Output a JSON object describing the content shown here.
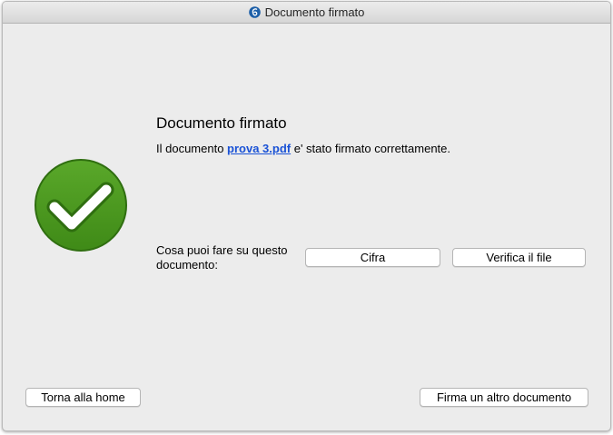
{
  "window": {
    "title": "Documento firmato"
  },
  "main": {
    "heading": "Documento firmato",
    "message_prefix": "Il documento ",
    "file_name": "prova 3.pdf",
    "message_suffix": " e' stato firmato correttamente.",
    "question": "Cosa puoi fare su questo documento:"
  },
  "actions": {
    "encrypt_label": "Cifra",
    "verify_label": "Verifica il file"
  },
  "footer": {
    "home_label": "Torna alla home",
    "sign_another_label": "Firma un altro documento"
  },
  "icons": {
    "app": "app-logo-icon",
    "status": "checkmark-success-icon"
  },
  "colors": {
    "success_green": "#4f9a1f",
    "link_blue": "#1a52d6",
    "app_icon_blue": "#1d5fa8"
  }
}
